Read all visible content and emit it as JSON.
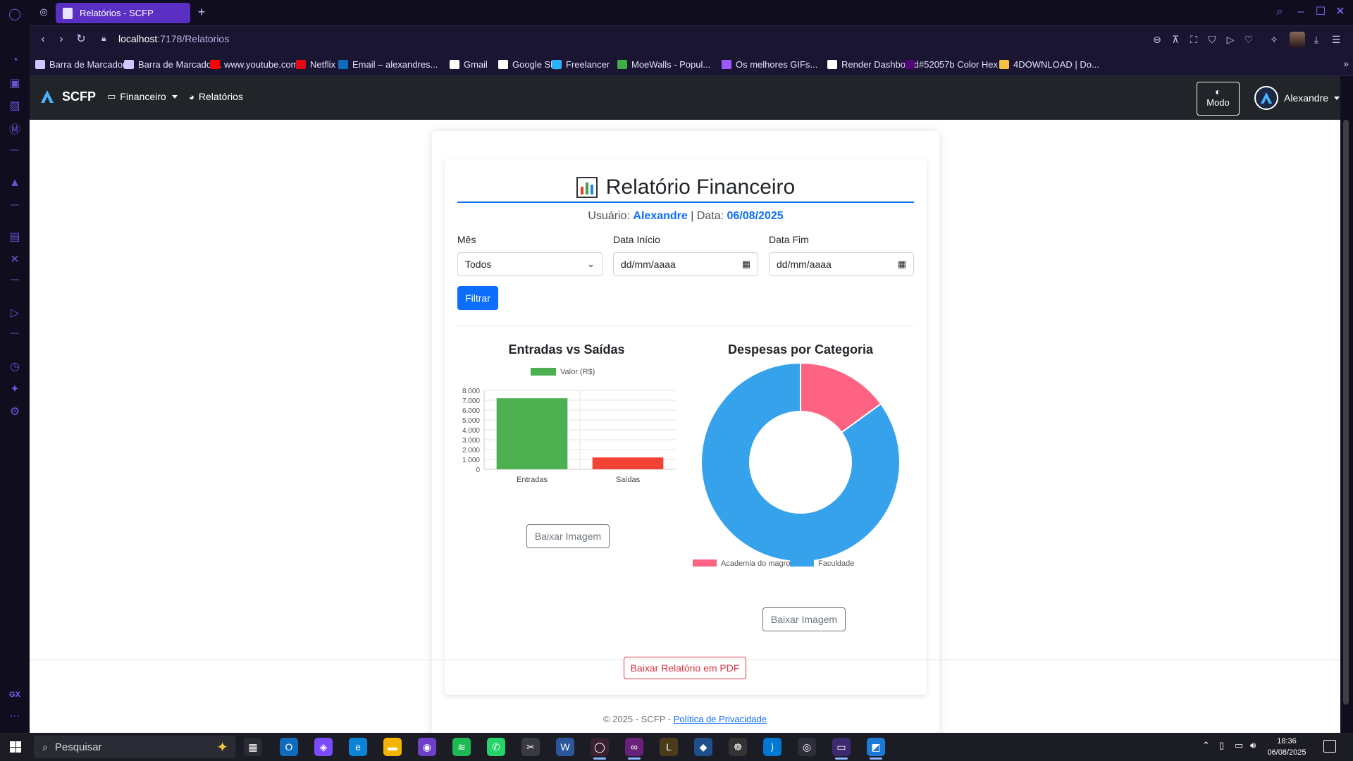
{
  "browser": {
    "tab_title": "Relatórios - SCFP",
    "new_tab": "+",
    "url_host": "localhost",
    "url_path": ":7178/Relatorios",
    "bookmarks": [
      {
        "label": "Barra de Marcador...",
        "color": "#cfc8ff"
      },
      {
        "label": "Barra de Marcador...",
        "color": "#cfc8ff"
      },
      {
        "label": "www.youtube.com",
        "color": "#ff0000"
      },
      {
        "label": "Netflix",
        "color": "#e50914"
      },
      {
        "label": "Email – alexandres...",
        "color": "#0f6cbd"
      },
      {
        "label": "Gmail",
        "color": "#ffffff"
      },
      {
        "label": "Google Sky",
        "color": "#ffffff"
      },
      {
        "label": "Freelancer",
        "color": "#29b2fe"
      },
      {
        "label": "MoeWalls - Popul...",
        "color": "#3fae49"
      },
      {
        "label": "Os melhores GIFs...",
        "color": "#9b59ff"
      },
      {
        "label": "Render Dashboard",
        "color": "#ffffff"
      },
      {
        "label": "#52057b Color Hex",
        "color": "#52057b"
      },
      {
        "label": "4DOWNLOAD | Do...",
        "color": "#f5c542"
      }
    ]
  },
  "app": {
    "brand": "SCFP",
    "nav_financeiro": "Financeiro",
    "nav_relatorios": "Relatórios",
    "mode_label": "Modo",
    "user_name": "Alexandre"
  },
  "report": {
    "title": "Relatório Financeiro",
    "user_label": "Usuário:",
    "user_value": "Alexandre",
    "separator": "| Data:",
    "date_value": "06/08/2025",
    "mes_label": "Mês",
    "mes_value": "Todos",
    "data_inicio_label": "Data Início",
    "data_inicio_placeholder": "dd/mm/aaaa",
    "data_fim_label": "Data Fim",
    "data_fim_placeholder": "dd/mm/aaaa",
    "filter_button": "Filtrar",
    "download_image": "Baixar Imagem",
    "download_pdf": "Baixar Relatório em PDF"
  },
  "chart_data": [
    {
      "type": "bar",
      "title": "Entradas vs Saídas",
      "categories": [
        "Entradas",
        "Saídas"
      ],
      "series": [
        {
          "name": "Valor (R$)",
          "values": [
            7200,
            1200
          ],
          "colors": [
            "#4caf50",
            "#f44336"
          ]
        }
      ],
      "ylim": [
        0,
        8000
      ],
      "yticks": [
        "0",
        "1.000",
        "2.000",
        "3.000",
        "4.000",
        "5.000",
        "6.000",
        "7.000",
        "8.000"
      ],
      "grid": true,
      "legend": "top"
    },
    {
      "type": "pie",
      "title": "Despesas por Categoria",
      "donut": true,
      "labels": [
        "Academia do magrones",
        "Faculdade"
      ],
      "values": [
        15,
        85
      ],
      "colors": [
        "#ff6384",
        "#36a2eb"
      ],
      "legend": "bottom"
    }
  ],
  "footer": {
    "text": "© 2025 - SCFP -",
    "link": "Política de Privacidade"
  },
  "taskbar": {
    "search_placeholder": "Pesquisar",
    "time": "18:36",
    "date": "06/08/2025"
  }
}
